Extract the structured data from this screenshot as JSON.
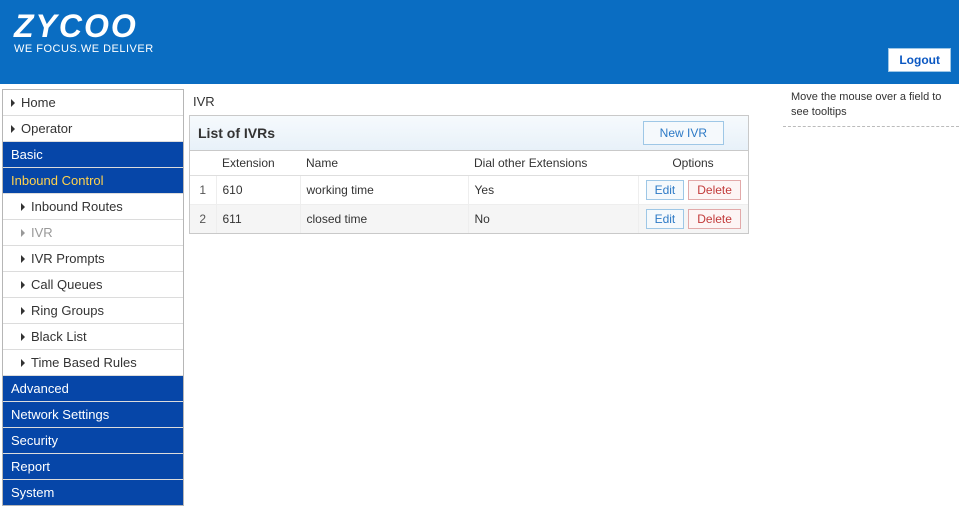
{
  "header": {
    "logo_main": "ZYCOO",
    "logo_tagline": "WE FOCUS.WE DELIVER",
    "logout_label": "Logout"
  },
  "sidebar": {
    "home": "Home",
    "operator": "Operator",
    "basic": "Basic",
    "inbound_control": "Inbound Control",
    "sub": {
      "inbound_routes": "Inbound Routes",
      "ivr": "IVR",
      "ivr_prompts": "IVR Prompts",
      "call_queues": "Call Queues",
      "ring_groups": "Ring Groups",
      "black_list": "Black List",
      "time_based_rules": "Time Based Rules"
    },
    "advanced": "Advanced",
    "network_settings": "Network Settings",
    "security": "Security",
    "report": "Report",
    "system": "System"
  },
  "page": {
    "title": "IVR",
    "panel_title": "List of IVRs",
    "new_ivr_label": "New IVR"
  },
  "table": {
    "headers": {
      "extension": "Extension",
      "name": "Name",
      "dial_other": "Dial other Extensions",
      "options": "Options"
    },
    "rows": [
      {
        "idx": "1",
        "ext": "610",
        "name": "working time",
        "dial": "Yes"
      },
      {
        "idx": "2",
        "ext": "611",
        "name": "closed time",
        "dial": "No"
      }
    ],
    "edit_label": "Edit",
    "delete_label": "Delete"
  },
  "tooltip_hint": "Move the mouse over a field to see tooltips"
}
